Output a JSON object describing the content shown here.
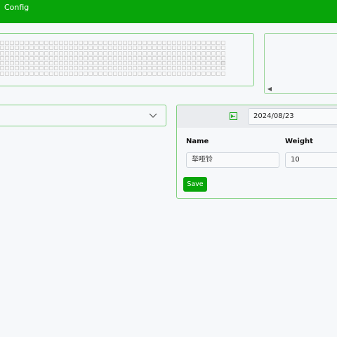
{
  "header": {
    "title": "Config"
  },
  "colors": {
    "accent": "#08a50a",
    "panel_border": "#7fd07f",
    "background": "#f6f8fa"
  },
  "grid_panel": {
    "highlighted_cell_icon": "selected-cell"
  },
  "side_panel": {
    "scroll_left_icon": "triangle-left-icon"
  },
  "dropdown": {
    "icon": "chevron-down-icon"
  },
  "editor": {
    "back_icon": "arrow-left-box-icon",
    "date_value": "2024/08/23",
    "name_label": "Name",
    "weight_label": "Weight",
    "name_value": "举哑铃",
    "weight_value": "10",
    "save_label": "Save"
  }
}
